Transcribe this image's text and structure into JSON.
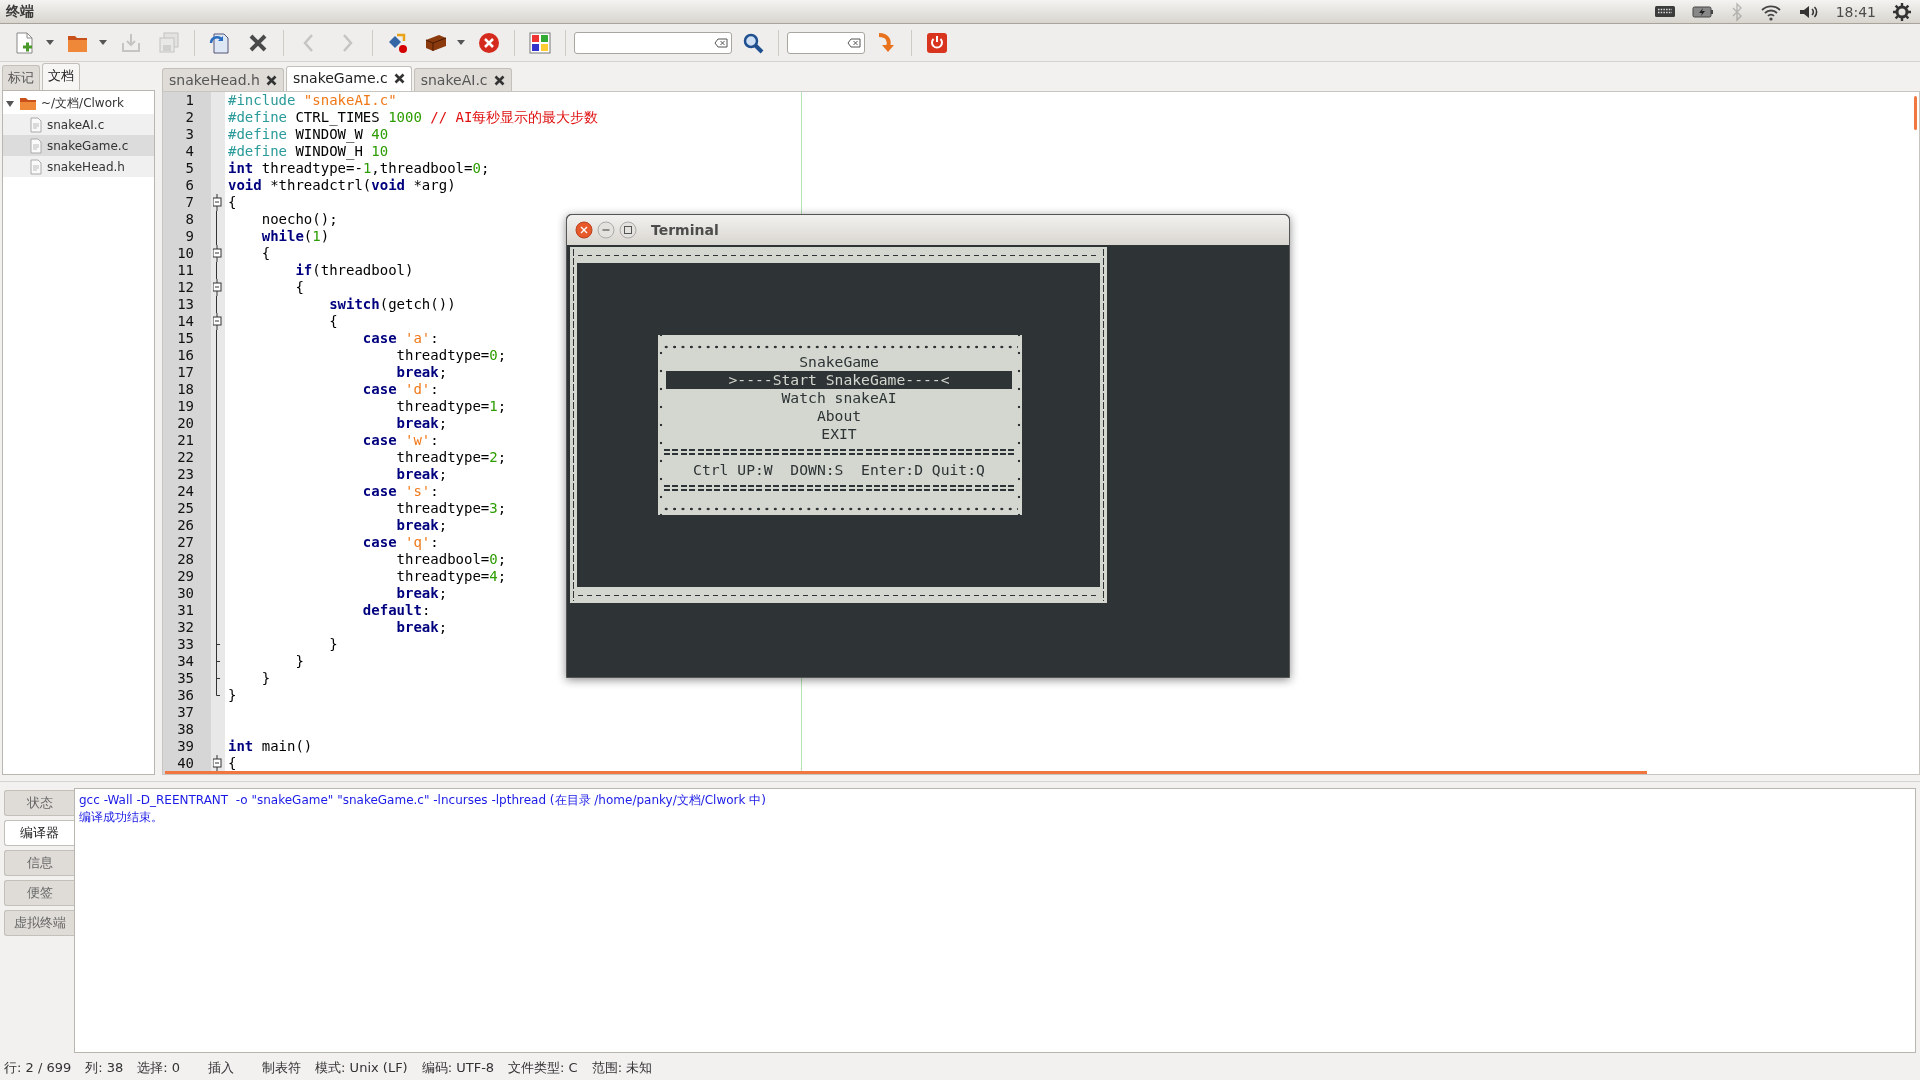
{
  "top_panel": {
    "title": "终端",
    "tray": [
      {
        "kind": "keyboard",
        "disabled": false
      },
      {
        "kind": "battery",
        "disabled": false
      },
      {
        "kind": "bluetooth",
        "disabled": true
      },
      {
        "kind": "wifi",
        "disabled": false
      },
      {
        "kind": "volume",
        "disabled": false
      },
      {
        "kind": "clock",
        "disabled": false,
        "text": "18:41"
      },
      {
        "kind": "session",
        "disabled": false
      }
    ]
  },
  "toolbar": {
    "groups": [
      [
        {
          "kind": "new",
          "disabled": false,
          "menu": true
        },
        {
          "kind": "open",
          "disabled": false,
          "menu": true
        },
        {
          "kind": "save",
          "disabled": true,
          "menu": false
        },
        {
          "kind": "saveall",
          "disabled": true,
          "menu": false
        }
      ],
      [
        {
          "kind": "revert",
          "disabled": false,
          "menu": false
        },
        {
          "kind": "close",
          "disabled": false,
          "menu": false
        }
      ],
      [
        {
          "kind": "back",
          "disabled": true,
          "menu": false
        },
        {
          "kind": "forward",
          "disabled": true,
          "menu": false
        }
      ],
      [
        {
          "kind": "compile",
          "disabled": false,
          "menu": false
        },
        {
          "kind": "build",
          "disabled": false,
          "menu": true
        },
        {
          "kind": "stop",
          "disabled": false,
          "menu": false
        }
      ],
      [
        {
          "kind": "color",
          "disabled": false,
          "menu": false
        }
      ],
      [
        {
          "kind": "field",
          "disabled": false,
          "menu": false
        },
        {
          "kind": "find",
          "disabled": false,
          "menu": false
        }
      ],
      [
        {
          "kind": "field",
          "disabled": false,
          "menu": false
        },
        {
          "kind": "jump",
          "disabled": false,
          "menu": false
        }
      ],
      [
        {
          "kind": "quit",
          "disabled": false,
          "menu": false
        }
      ]
    ]
  },
  "sidebar": {
    "tabs": [
      {
        "label": "标记",
        "selected": false
      },
      {
        "label": "文档",
        "selected": true
      }
    ],
    "tree": [
      {
        "label": "~/文档/Clwork",
        "expanded": true,
        "selected": false,
        "children": [
          {
            "label": "snakeAI.c",
            "selected": false
          },
          {
            "label": "snakeGame.c",
            "selected": true
          },
          {
            "label": "snakeHead.h",
            "selected": false
          }
        ]
      }
    ]
  },
  "editor": {
    "tabs": [
      {
        "label": "snakeHead.h",
        "selected": false
      },
      {
        "label": "snakeGame.c",
        "selected": true
      },
      {
        "label": "snakeAI.c",
        "selected": false
      }
    ],
    "lines": [
      {
        "number": "1",
        "kind": "plain",
        "tokens": [
          {
            "kind": "pre",
            "text": "#include"
          },
          {
            "kind": "str",
            "text": " \"snakeAI.c\""
          }
        ]
      },
      {
        "number": "2",
        "kind": "plain",
        "tokens": [
          {
            "kind": "pre",
            "text": "#define"
          },
          {
            "kind": "plain",
            "text": " CTRL_TIMES "
          },
          {
            "kind": "num",
            "text": "1000"
          },
          {
            "kind": "comment",
            "text": " // AI每秒显示的最大步数"
          }
        ]
      },
      {
        "number": "3",
        "kind": "plain",
        "tokens": [
          {
            "kind": "pre",
            "text": "#define"
          },
          {
            "kind": "plain",
            "text": " WINDOW_W "
          },
          {
            "kind": "num",
            "text": "40"
          }
        ]
      },
      {
        "number": "4",
        "kind": "plain",
        "tokens": [
          {
            "kind": "pre",
            "text": "#define"
          },
          {
            "kind": "plain",
            "text": " WINDOW_H "
          },
          {
            "kind": "num",
            "text": "10"
          }
        ]
      },
      {
        "number": "5",
        "kind": "plain",
        "tokens": [
          {
            "kind": "kw",
            "text": "int"
          },
          {
            "kind": "plain",
            "text": " threadtype=-"
          },
          {
            "kind": "num",
            "text": "1"
          },
          {
            "kind": "plain",
            "text": ",threadbool="
          },
          {
            "kind": "num",
            "text": "0"
          },
          {
            "kind": "plain",
            "text": ";"
          }
        ]
      },
      {
        "number": "6",
        "kind": "plain",
        "tokens": [
          {
            "kind": "kw",
            "text": "void"
          },
          {
            "kind": "plain",
            "text": " *threadctrl("
          },
          {
            "kind": "kw",
            "text": "void"
          },
          {
            "kind": "plain",
            "text": " *arg)"
          }
        ]
      },
      {
        "number": "7",
        "kind": "open",
        "tokens": [
          {
            "kind": "plain",
            "text": "{"
          }
        ]
      },
      {
        "number": "8",
        "kind": "line",
        "tokens": [
          {
            "kind": "plain",
            "text": "    noecho();"
          }
        ]
      },
      {
        "number": "9",
        "kind": "line",
        "tokens": [
          {
            "kind": "kw",
            "text": "    while"
          },
          {
            "kind": "plain",
            "text": "("
          },
          {
            "kind": "num",
            "text": "1"
          },
          {
            "kind": "plain",
            "text": ")"
          }
        ]
      },
      {
        "number": "10",
        "kind": "open",
        "tokens": [
          {
            "kind": "plain",
            "text": "    {"
          }
        ]
      },
      {
        "number": "11",
        "kind": "line",
        "tokens": [
          {
            "kind": "kw",
            "text": "        if"
          },
          {
            "kind": "plain",
            "text": "(threadbool)"
          }
        ]
      },
      {
        "number": "12",
        "kind": "open",
        "tokens": [
          {
            "kind": "plain",
            "text": "        {"
          }
        ]
      },
      {
        "number": "13",
        "kind": "line",
        "tokens": [
          {
            "kind": "kw",
            "text": "            switch"
          },
          {
            "kind": "plain",
            "text": "(getch())"
          }
        ]
      },
      {
        "number": "14",
        "kind": "open",
        "tokens": [
          {
            "kind": "plain",
            "text": "            {"
          }
        ]
      },
      {
        "number": "15",
        "kind": "line",
        "tokens": [
          {
            "kind": "kw",
            "text": "                case"
          },
          {
            "kind": "str",
            "text": " 'a'"
          },
          {
            "kind": "plain",
            "text": ":"
          }
        ]
      },
      {
        "number": "16",
        "kind": "line",
        "tokens": [
          {
            "kind": "plain",
            "text": "                    threadtype="
          },
          {
            "kind": "num",
            "text": "0"
          },
          {
            "kind": "plain",
            "text": ";"
          }
        ]
      },
      {
        "number": "17",
        "kind": "line",
        "tokens": [
          {
            "kind": "kw",
            "text": "                    break"
          },
          {
            "kind": "plain",
            "text": ";"
          }
        ]
      },
      {
        "number": "18",
        "kind": "line",
        "tokens": [
          {
            "kind": "kw",
            "text": "                case"
          },
          {
            "kind": "str",
            "text": " 'd'"
          },
          {
            "kind": "plain",
            "text": ":"
          }
        ]
      },
      {
        "number": "19",
        "kind": "line",
        "tokens": [
          {
            "kind": "plain",
            "text": "                    threadtype="
          },
          {
            "kind": "num",
            "text": "1"
          },
          {
            "kind": "plain",
            "text": ";"
          }
        ]
      },
      {
        "number": "20",
        "kind": "line",
        "tokens": [
          {
            "kind": "kw",
            "text": "                    break"
          },
          {
            "kind": "plain",
            "text": ";"
          }
        ]
      },
      {
        "number": "21",
        "kind": "line",
        "tokens": [
          {
            "kind": "kw",
            "text": "                case"
          },
          {
            "kind": "str",
            "text": " 'w'"
          },
          {
            "kind": "plain",
            "text": ":"
          }
        ]
      },
      {
        "number": "22",
        "kind": "line",
        "tokens": [
          {
            "kind": "plain",
            "text": "                    threadtype="
          },
          {
            "kind": "num",
            "text": "2"
          },
          {
            "kind": "plain",
            "text": ";"
          }
        ]
      },
      {
        "number": "23",
        "kind": "line",
        "tokens": [
          {
            "kind": "kw",
            "text": "                    break"
          },
          {
            "kind": "plain",
            "text": ";"
          }
        ]
      },
      {
        "number": "24",
        "kind": "line",
        "tokens": [
          {
            "kind": "kw",
            "text": "                case"
          },
          {
            "kind": "str",
            "text": " 's'"
          },
          {
            "kind": "plain",
            "text": ":"
          }
        ]
      },
      {
        "number": "25",
        "kind": "line",
        "tokens": [
          {
            "kind": "plain",
            "text": "                    threadtype="
          },
          {
            "kind": "num",
            "text": "3"
          },
          {
            "kind": "plain",
            "text": ";"
          }
        ]
      },
      {
        "number": "26",
        "kind": "line",
        "tokens": [
          {
            "kind": "kw",
            "text": "                    break"
          },
          {
            "kind": "plain",
            "text": ";"
          }
        ]
      },
      {
        "number": "27",
        "kind": "line",
        "tokens": [
          {
            "kind": "kw",
            "text": "                case"
          },
          {
            "kind": "str",
            "text": " 'q'"
          },
          {
            "kind": "plain",
            "text": ":"
          }
        ]
      },
      {
        "number": "28",
        "kind": "line",
        "tokens": [
          {
            "kind": "plain",
            "text": "                    threadbool="
          },
          {
            "kind": "num",
            "text": "0"
          },
          {
            "kind": "plain",
            "text": ";"
          }
        ]
      },
      {
        "number": "29",
        "kind": "line",
        "tokens": [
          {
            "kind": "plain",
            "text": "                    threadtype="
          },
          {
            "kind": "num",
            "text": "4"
          },
          {
            "kind": "plain",
            "text": ";"
          }
        ]
      },
      {
        "number": "30",
        "kind": "line",
        "tokens": [
          {
            "kind": "kw",
            "text": "                    break"
          },
          {
            "kind": "plain",
            "text": ";"
          }
        ]
      },
      {
        "number": "31",
        "kind": "line",
        "tokens": [
          {
            "kind": "kw",
            "text": "                default"
          },
          {
            "kind": "plain",
            "text": ":"
          }
        ]
      },
      {
        "number": "32",
        "kind": "line",
        "tokens": [
          {
            "kind": "kw",
            "text": "                    break"
          },
          {
            "kind": "plain",
            "text": ";"
          }
        ]
      },
      {
        "number": "33",
        "kind": "branch",
        "tokens": [
          {
            "kind": "plain",
            "text": "            }"
          }
        ]
      },
      {
        "number": "34",
        "kind": "branch",
        "tokens": [
          {
            "kind": "plain",
            "text": "        }"
          }
        ]
      },
      {
        "number": "35",
        "kind": "branch",
        "tokens": [
          {
            "kind": "plain",
            "text": "    }"
          }
        ]
      },
      {
        "number": "36",
        "kind": "end",
        "tokens": [
          {
            "kind": "plain",
            "text": "}"
          }
        ]
      },
      {
        "number": "37",
        "kind": "plain"
      },
      {
        "number": "38",
        "kind": "plain"
      },
      {
        "number": "39",
        "kind": "plain",
        "tokens": [
          {
            "kind": "kw",
            "text": "int"
          },
          {
            "kind": "plain",
            "text": " main()"
          }
        ]
      },
      {
        "number": "40",
        "kind": "open",
        "tokens": [
          {
            "kind": "plain",
            "text": "{"
          }
        ]
      }
    ]
  },
  "terminal": {
    "title": "Terminal",
    "menu": {
      "title": "SnakeGame",
      "items": [
        {
          "label": ">----Start SnakeGame----<",
          "selected": true
        },
        {
          "label": "Watch snakeAI",
          "selected": false
        },
        {
          "label": "About",
          "selected": false
        },
        {
          "label": "EXIT",
          "selected": false
        }
      ],
      "help": "Ctrl UP:W  DOWN:S  Enter:D Quit:Q"
    }
  },
  "bottom_panel": {
    "tabs": [
      {
        "label": "状态",
        "selected": false
      },
      {
        "label": "编译器",
        "selected": true
      },
      {
        "label": "信息",
        "selected": false
      },
      {
        "label": "便签",
        "selected": false
      },
      {
        "label": "虚拟终端",
        "selected": false
      }
    ],
    "messages": [
      "gcc -Wall -D_REENTRANT  -o \"snakeGame\" \"snakeGame.c\" -lncurses -lpthread (在目录 /home/panky/文档/Clwork 中)",
      "编译成功结束。"
    ]
  },
  "status_bar": [
    "行: 2 / 699",
    "列: 38",
    "选择: 0",
    "插入",
    "制表符",
    "模式: Unix (LF)",
    "编码: UTF-8",
    "文件类型: C",
    "范围: 未知"
  ]
}
